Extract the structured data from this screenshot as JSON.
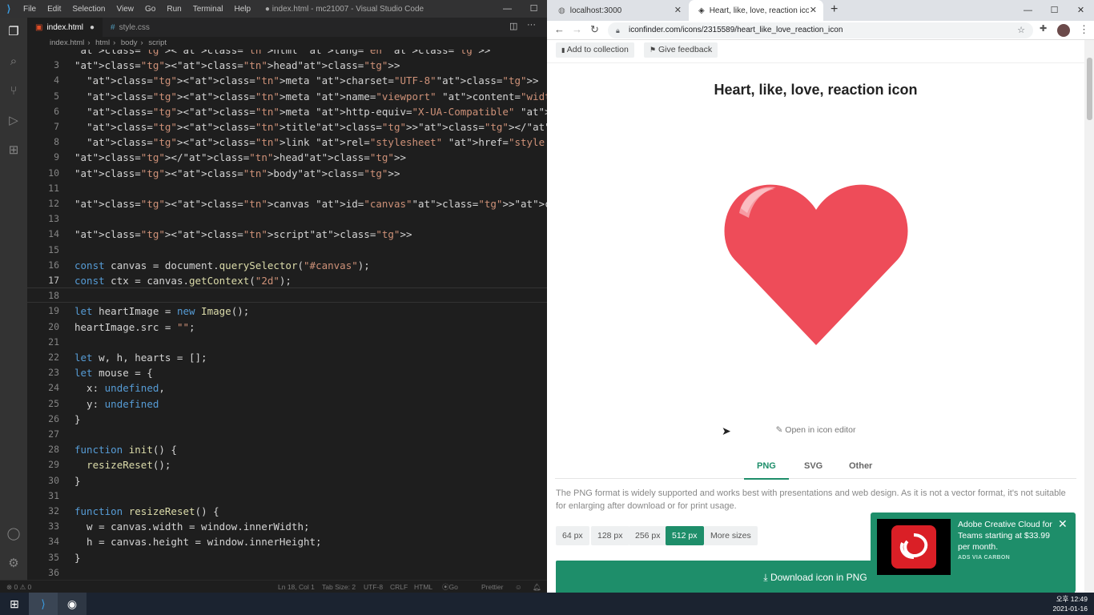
{
  "vscode": {
    "menu": [
      "File",
      "Edit",
      "Selection",
      "View",
      "Go",
      "Run",
      "Terminal",
      "Help"
    ],
    "window_title": "● index.html - mc21007 - Visual Studio Code",
    "tabs": [
      {
        "label": "index.html",
        "modified": "●"
      },
      {
        "label": "style.css"
      }
    ],
    "breadcrumb": [
      "index.html",
      "html",
      "body",
      "script"
    ],
    "line_numbers": [
      "",
      "3",
      "4",
      "5",
      "6",
      "7",
      "8",
      "9",
      "10",
      "11",
      "12",
      "13",
      "14",
      "15",
      "16",
      "17",
      "18",
      "19",
      "20",
      "21",
      "22",
      "23",
      "24",
      "25",
      "26",
      "27",
      "28",
      "29",
      "30",
      "31",
      "32",
      "33",
      "34",
      "35",
      "36"
    ],
    "code_lines": [
      "<html lang=\"en\">",
      "<head>",
      "  <meta charset=\"UTF-8\">",
      "  <meta name=\"viewport\" content=\"width=device-width, initial-scale=1.0\">",
      "  <meta http-equiv=\"X-UA-Compatible\" content=\"ie=edge\">",
      "  <title></title>",
      "  <link rel=\"stylesheet\" href=\"style.css\">",
      "</head>",
      "<body>",
      "",
      "<canvas id=\"canvas\"></canvas>",
      "",
      "<script>",
      "",
      "const canvas = document.querySelector(\"#canvas\");",
      "const ctx = canvas.getContext(\"2d\");",
      "",
      "let heartImage = new Image();",
      "heartImage.src = \"\";",
      "",
      "let w, h, hearts = [];",
      "let mouse = {",
      "  x: undefined,",
      "  y: undefined",
      "}",
      "",
      "function init() {",
      "  resizeReset();",
      "}",
      "",
      "function resizeReset() {",
      "  w = canvas.width = window.innerWidth;",
      "  h = canvas.height = window.innerHeight;",
      "}",
      ""
    ],
    "status": {
      "errors": "⊗ 0 ⚠ 0",
      "position": "Ln 18, Col 1",
      "tab_size": "Tab Size: 2",
      "encoding": "UTF-8",
      "eol": "CRLF",
      "language": "HTML",
      "go_live": "Go Live",
      "prettier": "Prettier"
    }
  },
  "chrome": {
    "tabs": [
      {
        "label": "localhost:3000"
      },
      {
        "label": "Heart, like, love, reaction icon - "
      }
    ],
    "url": "iconfinder.com/icons/2315589/heart_like_love_reaction_icon",
    "page": {
      "add_collection": "Add to collection",
      "give_feedback": "Give feedback",
      "title": "Heart, like, love, reaction icon",
      "open_editor": "Open in icon editor",
      "format_tabs": [
        "PNG",
        "SVG",
        "Other"
      ],
      "format_desc": "The PNG format is widely supported and works best with presentations and web design. As it is not a vector format, it's not suitable for enlarging after download or for print usage.",
      "sizes": [
        "64 px",
        "128 px",
        "256 px",
        "512 px",
        "More sizes"
      ],
      "download": "Download icon in PNG",
      "ad_text": "Adobe Creative Cloud for Teams starting at $33.99 per month.",
      "ad_via": "ADS VIA CARBON"
    }
  },
  "taskbar": {
    "time": "오후 12:49",
    "date": "2021-01-16"
  },
  "colors": {
    "accent_green": "#1e8e6a",
    "heart": "#ee4c59"
  }
}
